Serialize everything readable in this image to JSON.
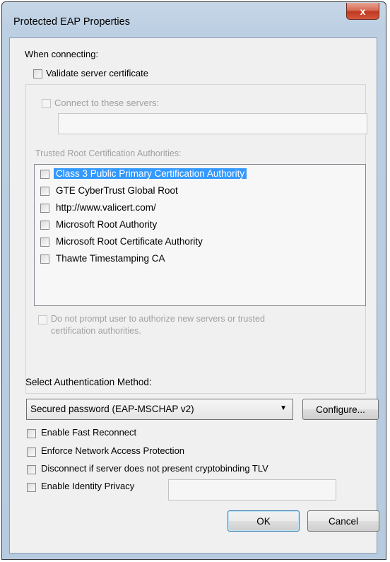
{
  "window": {
    "title": "Protected EAP Properties",
    "close_label": "x"
  },
  "connecting": {
    "heading": "When connecting:",
    "validate_label": "Validate server certificate",
    "connect_servers_label": "Connect to these servers:",
    "servers_value": "",
    "trusted_heading": "Trusted Root Certification Authorities:",
    "authorities": [
      {
        "label": "Class 3 Public Primary Certification Authority",
        "selected": true
      },
      {
        "label": "GTE CyberTrust Global Root",
        "selected": false
      },
      {
        "label": "http://www.valicert.com/",
        "selected": false
      },
      {
        "label": "Microsoft Root Authority",
        "selected": false
      },
      {
        "label": "Microsoft Root Certificate Authority",
        "selected": false
      },
      {
        "label": "Thawte Timestamping CA",
        "selected": false
      }
    ],
    "no_prompt_line1": "Do not prompt user to authorize new servers or trusted",
    "no_prompt_line2": "certification authorities."
  },
  "auth": {
    "heading": "Select Authentication Method:",
    "method_value": "Secured password (EAP-MSCHAP v2)",
    "configure_label": "Configure..."
  },
  "options": {
    "fast_reconnect": "Enable Fast Reconnect",
    "nap": "Enforce Network Access Protection",
    "cryptobinding": "Disconnect if server does not present cryptobinding TLV",
    "identity_privacy": "Enable Identity Privacy",
    "identity_value": ""
  },
  "buttons": {
    "ok": "OK",
    "cancel": "Cancel"
  },
  "colors": {
    "selection": "#3399ff",
    "close_button": "#c0391f",
    "dialog_face": "#f0f0f0"
  }
}
